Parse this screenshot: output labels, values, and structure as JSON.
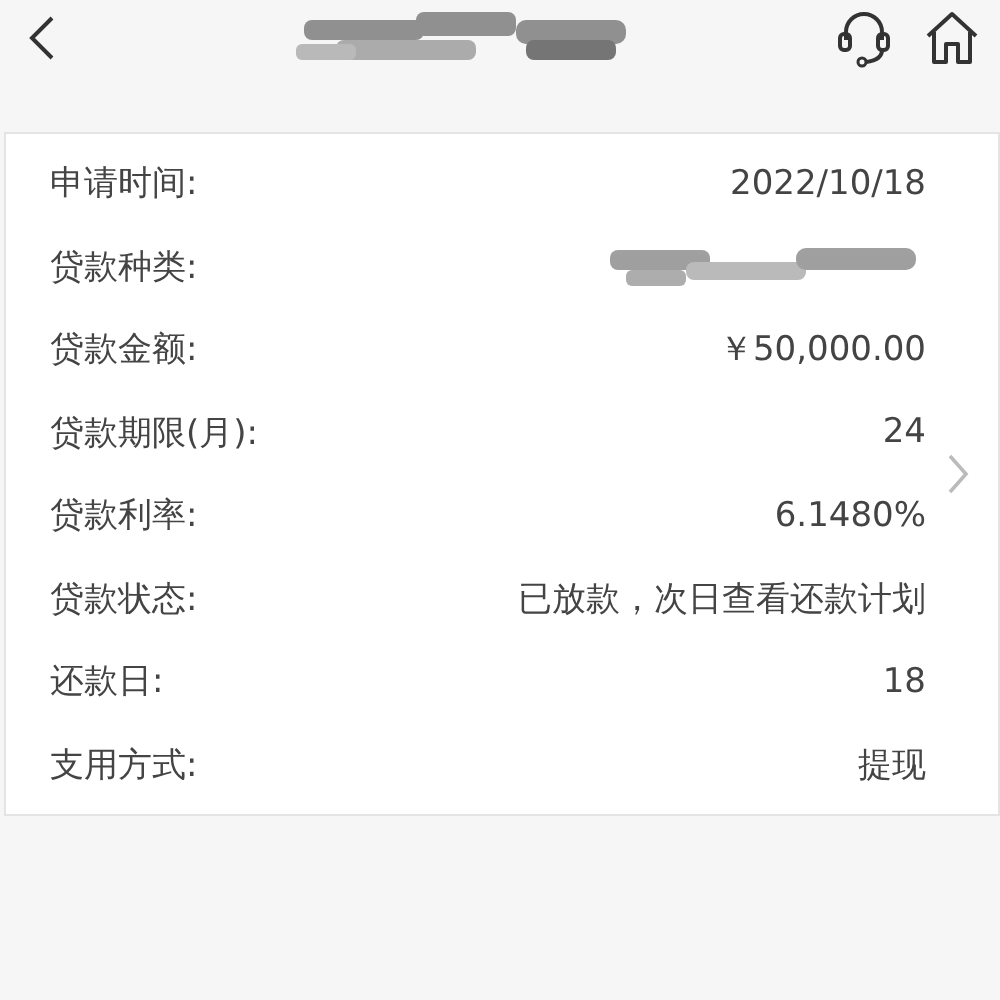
{
  "header": {
    "title_redacted": true
  },
  "rows": [
    {
      "label": "申请时间:",
      "kind": "text",
      "value": "2022/10/18"
    },
    {
      "label": "贷款种类:",
      "kind": "redacted"
    },
    {
      "label": "贷款金额:",
      "kind": "text",
      "value": "￥50,000.00"
    },
    {
      "label": "贷款期限(月):",
      "kind": "text",
      "value": "24"
    },
    {
      "label": "贷款利率:",
      "kind": "text",
      "value": "6.1480%"
    },
    {
      "label": "贷款状态:",
      "kind": "text",
      "value": "已放款，次日查看还款计划"
    },
    {
      "label": "还款日:",
      "kind": "text",
      "value": "18"
    },
    {
      "label": "支用方式:",
      "kind": "text",
      "value": "提现"
    }
  ]
}
